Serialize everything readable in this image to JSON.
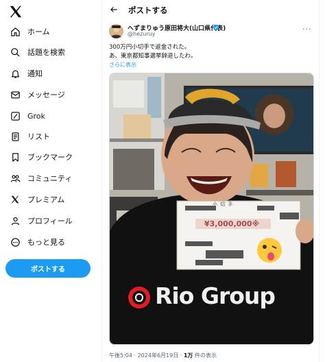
{
  "sidebar": {
    "items": [
      {
        "label": "ホーム",
        "icon": "home-icon"
      },
      {
        "label": "話題を検索",
        "icon": "search-icon"
      },
      {
        "label": "通知",
        "icon": "bell-icon"
      },
      {
        "label": "メッセージ",
        "icon": "mail-icon"
      },
      {
        "label": "Grok",
        "icon": "grok-icon"
      },
      {
        "label": "リスト",
        "icon": "list-icon"
      },
      {
        "label": "ブックマーク",
        "icon": "bookmark-icon"
      },
      {
        "label": "コミュニティ",
        "icon": "community-icon"
      },
      {
        "label": "プレミアム",
        "icon": "x-logo-icon"
      },
      {
        "label": "プロフィール",
        "icon": "person-icon"
      },
      {
        "label": "もっと見る",
        "icon": "more-circle-icon"
      }
    ],
    "post_button": "ポストする"
  },
  "header": {
    "title": "ポストする"
  },
  "tweet": {
    "display_name": "へずまりゅう原田将大(山口県代表)",
    "handle": "@hezuruy",
    "text_line1": "300万円小切手で返金された。",
    "text_line2": "あ、東京都知事選挙辞退したわ。",
    "show_more": "さらに表示",
    "photo_banner_text": "Rio Group",
    "cheque_amount": "¥3,000,000※",
    "cheque_title": "小 切 手",
    "time": "午後5:04 · 2024年6月19日 · ",
    "views": "1万",
    "views_suffix": " 件の表示"
  },
  "colors": {
    "accent": "#1d9bf0",
    "text": "#0f1419",
    "muted": "#536471"
  }
}
